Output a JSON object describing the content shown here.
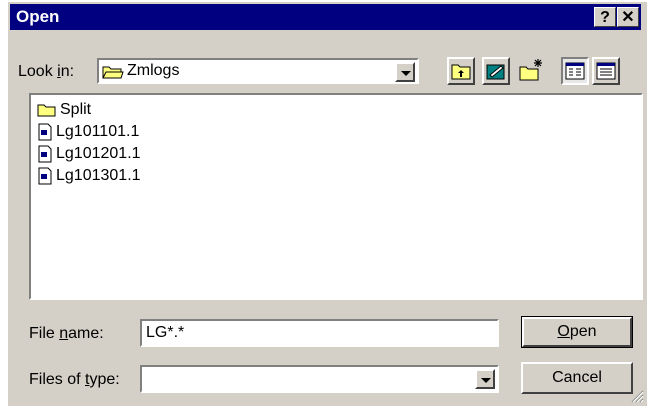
{
  "window": {
    "title": "Open",
    "help_glyph": "?",
    "close_glyph": "✕"
  },
  "lookin": {
    "label_pre": "Look ",
    "label_u": "i",
    "label_post": "n:",
    "value": "Zmlogs"
  },
  "files": [
    {
      "name": "Split",
      "type": "folder"
    },
    {
      "name": "Lg101101.1",
      "type": "file"
    },
    {
      "name": "Lg101201.1",
      "type": "file"
    },
    {
      "name": "Lg101301.1",
      "type": "file"
    }
  ],
  "filename": {
    "label_pre": "File ",
    "label_u": "n",
    "label_post": "ame:",
    "value": "LG*.*"
  },
  "filetype": {
    "label_pre": "Files of ",
    "label_u": "t",
    "label_post": "ype:",
    "value": ""
  },
  "buttons": {
    "open_u": "O",
    "open_rest": "pen",
    "cancel": "Cancel"
  },
  "icons": {
    "up": "up-folder-icon",
    "desktop": "desktop-icon",
    "new_folder": "new-folder-icon",
    "list_view": "list-view-icon",
    "details_view": "details-view-icon"
  },
  "colors": {
    "titlebar": "#000080",
    "face": "#d4d0c8",
    "folder": "#ffff80"
  }
}
